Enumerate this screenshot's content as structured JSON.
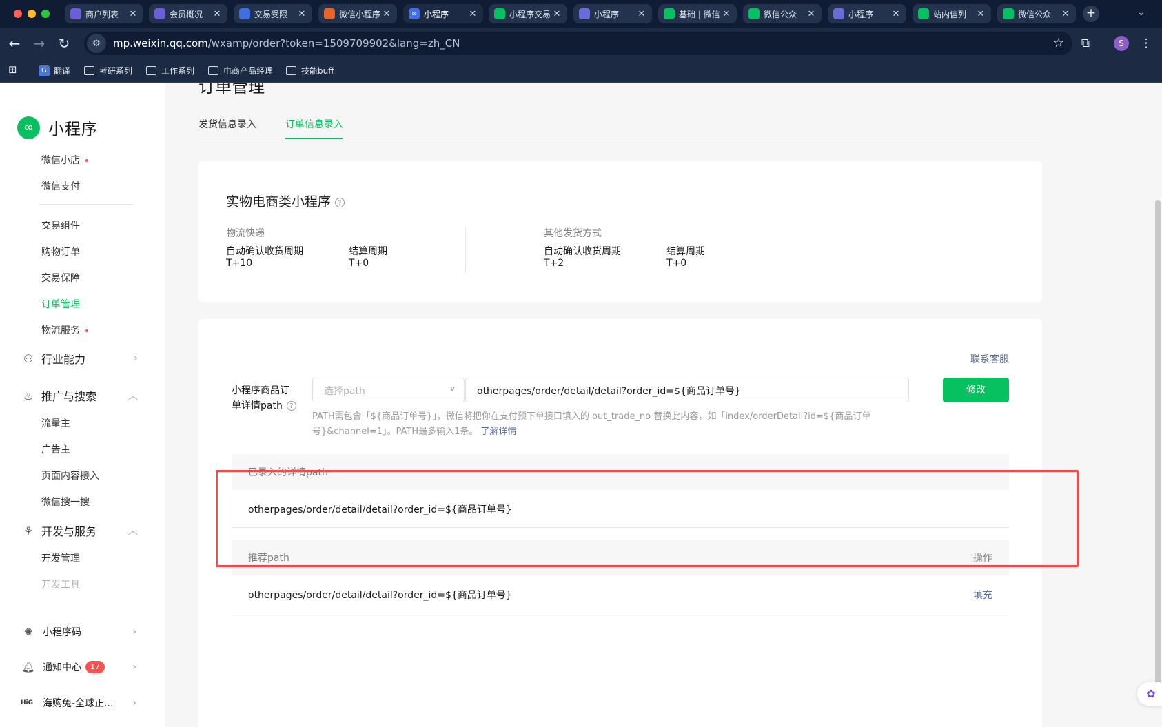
{
  "browser": {
    "tabs": [
      {
        "label": "商户列表",
        "fav_color": "#6b5fd8"
      },
      {
        "label": "会员概况",
        "fav_color": "#6b5fd8"
      },
      {
        "label": "交易受限",
        "fav_color": "#3f6fe3"
      },
      {
        "label": "微信小程序",
        "fav_color": "#e8642b"
      },
      {
        "label": "小程序",
        "fav_color": "#3f6fe3",
        "active": true
      },
      {
        "label": "小程序交易",
        "fav_color": "#07c160"
      },
      {
        "label": "小程序",
        "fav_color": "#6a6ad8"
      },
      {
        "label": "基础 | 微信",
        "fav_color": "#07c160"
      },
      {
        "label": "微信公众",
        "fav_color": "#07c160"
      },
      {
        "label": "小程序",
        "fav_color": "#6a6ad8"
      },
      {
        "label": "站内信列",
        "fav_color": "#07c160"
      },
      {
        "label": "微信公众",
        "fav_color": "#07c160"
      }
    ],
    "url_host": "mp.weixin.qq.com",
    "url_path": "/wxamp/order?token=1509709902&lang=zh_CN",
    "profile_initial": "S",
    "bookmarks": [
      {
        "label": "翻译",
        "icon": "google-translate-icon"
      },
      {
        "label": "考研系列",
        "icon": "folder-icon"
      },
      {
        "label": "工作系列",
        "icon": "folder-icon"
      },
      {
        "label": "电商产品经理",
        "icon": "folder-icon"
      },
      {
        "label": "技能buff",
        "icon": "folder-icon"
      }
    ]
  },
  "sidebar": {
    "app_name": "小程序",
    "items_top": [
      {
        "label": "微信小店",
        "dot": true
      },
      {
        "label": "微信支付",
        "dot": false
      }
    ],
    "items_trade": [
      {
        "label": "交易组件"
      },
      {
        "label": "购物订单"
      },
      {
        "label": "交易保障"
      },
      {
        "label": "订单管理",
        "active": true
      },
      {
        "label": "物流服务",
        "dot": true
      }
    ],
    "group_industry": "行业能力",
    "group_promo": "推广与搜索",
    "items_promo": [
      "流量主",
      "广告主",
      "页面内容接入",
      "微信搜一搜"
    ],
    "group_dev": "开发与服务",
    "items_dev": [
      "开发管理",
      "开发工具"
    ],
    "qrcode": "小程序码",
    "notify": "通知中心",
    "notify_count": "17",
    "account": "海购兔-全球正...",
    "account_logo": "HiG"
  },
  "main": {
    "title": "订单管理",
    "tabs": [
      "发货信息录入",
      "订单信息录入"
    ],
    "active_tab": 1,
    "card1": {
      "title": "实物电商类小程序",
      "help": "?",
      "left": {
        "heading": "物流快递",
        "col1_label": "自动确认收货周期",
        "col1_value": "T+10",
        "col2_label": "结算周期",
        "col2_value": "T+0"
      },
      "right": {
        "heading": "其他发货方式",
        "col1_label": "自动确认收货周期",
        "col1_value": "T+2",
        "col2_label": "结算周期",
        "col2_value": "T+0"
      }
    },
    "card2": {
      "contact": "联系客服",
      "form_label_line1": "小程序商品订",
      "form_label_line2": "单详情path",
      "select_placeholder": "选择path",
      "path_value": "otherpages/order/detail/detail?order_id=${商品订单号}",
      "modify_button": "修改",
      "hint_line1": "PATH需包含「${商品订单号}」，微信将把你在支付预下单接口填入的 out_trade_no 替换此内容，如「index/orderDetail?id=${商品订单",
      "hint_line2": "号}&channel=1」。PATH最多输入1条。",
      "hint_link": "了解详情",
      "entered_table": {
        "header": "已录入的详情path",
        "rows": [
          "otherpages/order/detail/detail?order_id=${商品订单号}"
        ]
      },
      "recommend_table": {
        "header": "推荐path",
        "action_header": "操作",
        "rows": [
          {
            "path": "otherpages/order/detail/detail?order_id=${商品订单号}",
            "action": "填充"
          }
        ]
      }
    }
  },
  "colors": {
    "accent": "#07c160",
    "link": "#576b95",
    "highlight_box": "#f04b4b",
    "badge": "#fa5151"
  }
}
